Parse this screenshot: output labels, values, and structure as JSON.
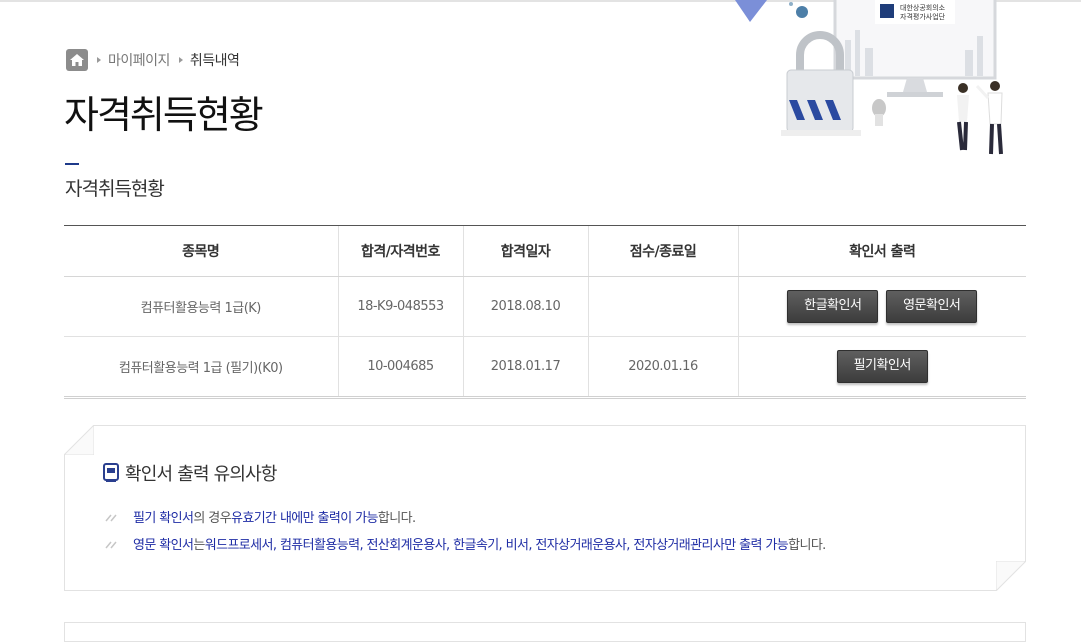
{
  "breadcrumb": {
    "home_icon": "home-icon",
    "items": [
      "마이페이지",
      "취득내역"
    ]
  },
  "page_title": "자격취득현황",
  "section_title": "자격취득현황",
  "hero": {
    "logo_text_1": "대한상공회의소",
    "logo_text_2": "자격평가사업단"
  },
  "table": {
    "headers": [
      "종목명",
      "합격/자격번호",
      "합격일자",
      "점수/종료일",
      "확인서 출력"
    ],
    "rows": [
      {
        "name": "컴퓨터활용능력 1급(K)",
        "number": "18-K9-048553",
        "date": "2018.08.10",
        "end": "",
        "buttons": [
          "한글확인서",
          "영문확인서"
        ]
      },
      {
        "name": "컴퓨터활용능력 1급 (필기)(K0)",
        "number": "10-004685",
        "date": "2018.01.17",
        "end": "2020.01.16",
        "buttons": [
          "필기확인서"
        ]
      }
    ]
  },
  "notice": {
    "title": "확인서 출력 유의사항",
    "line1": {
      "a": "필기 확인서",
      "b": "의 경우 ",
      "c": "유효기간 내에만 출력이 가능",
      "d": "합니다."
    },
    "line2": {
      "a": "영문 확인서",
      "b": "는 ",
      "c": "워드프로세서, 컴퓨터활용능력, 전산회계운용사, 한글속기, 비서, 전자상거래운용사, 전자상거래관리사만 출력 가능",
      "d": "합니다."
    }
  }
}
